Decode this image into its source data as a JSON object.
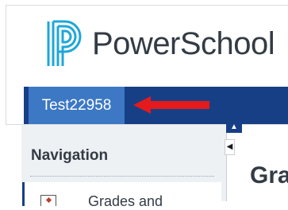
{
  "header": {
    "logo_text": "PowerSchool",
    "brand_color": "#1ea7d8",
    "user_tab_label": "Test22958",
    "bar_color": "#173f86",
    "tab_color": "#3c78c3",
    "annotation_arrow_color": "#e41a1c"
  },
  "navigation": {
    "heading": "Navigation",
    "items": [
      {
        "label": "Grades and",
        "icon": "gradebook-icon"
      }
    ],
    "collapse_up_icon": "▲",
    "collapse_left_icon": "◀"
  },
  "main": {
    "title": "Gra"
  }
}
